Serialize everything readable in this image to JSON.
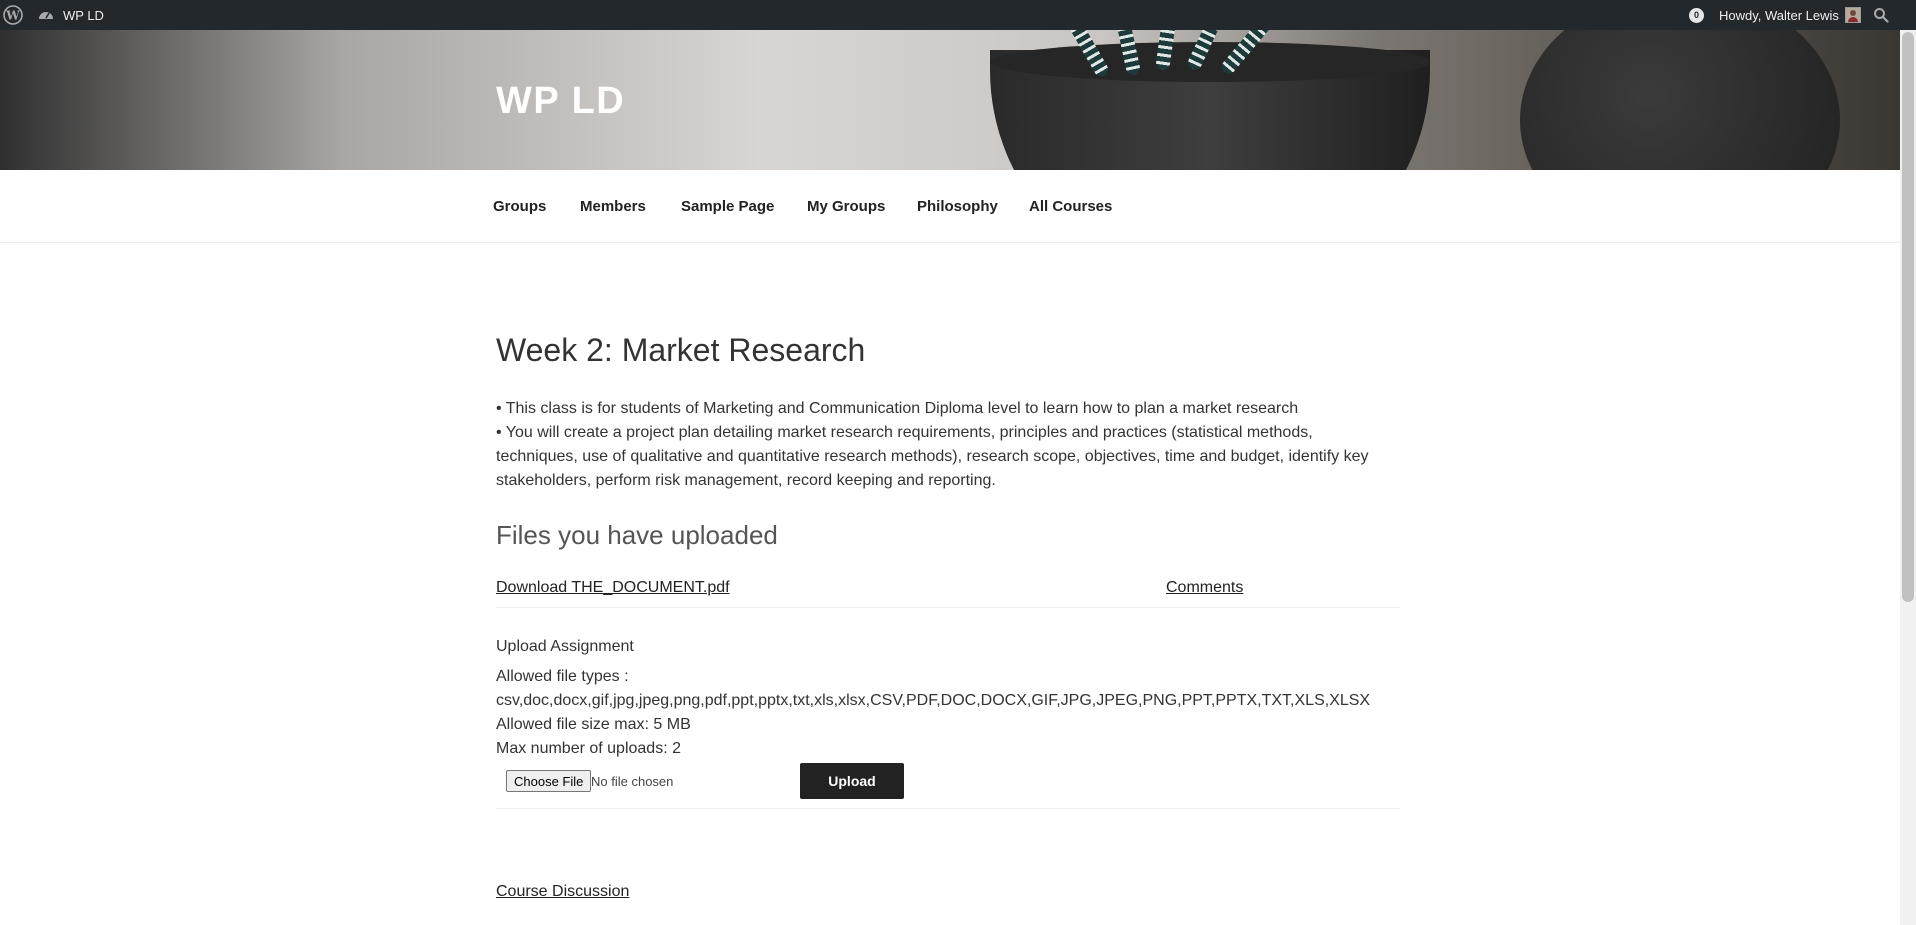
{
  "adminbar": {
    "site_name": "WP LD",
    "notification_count": "0",
    "howdy": "Howdy, Walter Lewis"
  },
  "site": {
    "title": "WP LD"
  },
  "nav": {
    "items": [
      {
        "label": "Groups"
      },
      {
        "label": "Members"
      },
      {
        "label": "Sample Page"
      },
      {
        "label": "My Groups"
      },
      {
        "label": "Philosophy"
      },
      {
        "label": "All Courses"
      }
    ]
  },
  "content": {
    "title": "Week 2: Market Research",
    "bullets": [
      "• This class is for students of Marketing and Communication Diploma level to learn how to plan a market research",
      "• You will create a project plan detailing market research requirements, principles and practices (statistical methods, techniques, use of qualitative and quantitative research methods), research scope, objectives, time and budget, identify key stakeholders, perform risk management, record keeping and reporting."
    ],
    "files_heading": "Files you have uploaded",
    "download_link": "Download THE_DOCUMENT.pdf",
    "comments_link": "Comments",
    "upload": {
      "heading": "Upload Assignment",
      "allowed_types_label": "Allowed file types :",
      "allowed_types": "csv,doc,docx,gif,jpg,jpeg,png,pdf,ppt,pptx,txt,xls,xlsx,CSV,PDF,DOC,DOCX,GIF,JPG,JPEG,PNG,PPT,PPTX,TXT,XLS,XLSX",
      "max_size": "Allowed file size max: 5 MB",
      "max_uploads": "Max number of uploads: 2",
      "choose_file": "Choose File",
      "no_file": "No file chosen",
      "upload_button": "Upload"
    },
    "discussion_link": "Course Discussion"
  }
}
